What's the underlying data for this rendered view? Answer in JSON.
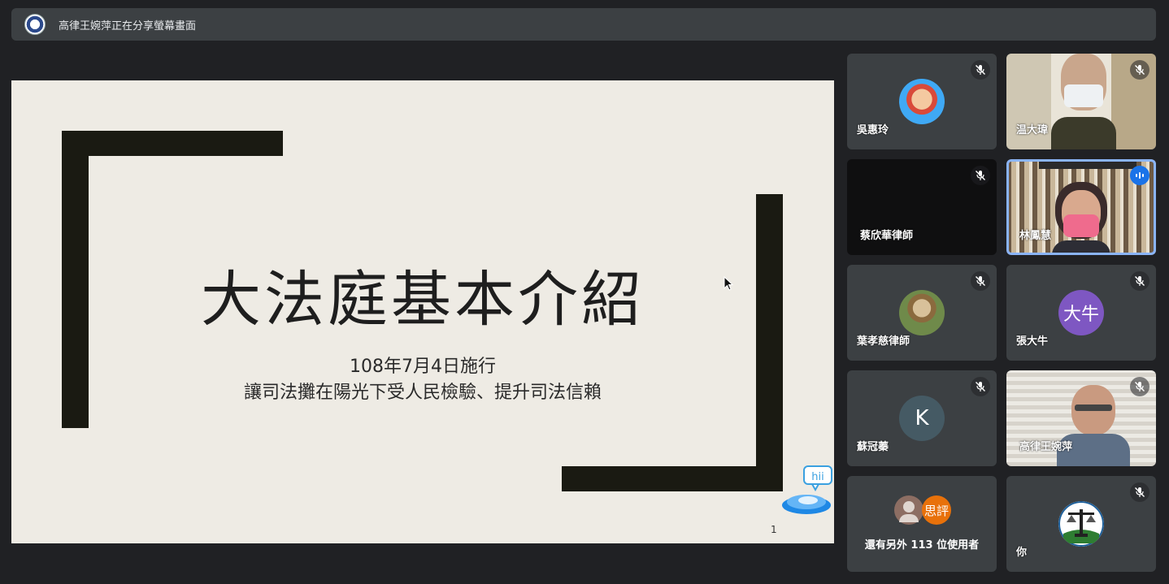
{
  "header": {
    "sharing_text": "高律王婉萍正在分享螢幕畫面"
  },
  "slide": {
    "title": "大法庭基本介紹",
    "subtitle_line1": "108年7月4日施行",
    "subtitle_line2": "讓司法攤在陽光下受人民檢驗、提升司法信賴",
    "page_number": "1",
    "mascot_text": "hii"
  },
  "participants": {
    "p1": {
      "name": "吳惠玲",
      "muted": true
    },
    "p2": {
      "name": "温大瑋",
      "muted": true
    },
    "p3": {
      "name": "蔡欣華律師",
      "muted": true
    },
    "p4": {
      "name": "林鳳慧",
      "speaking": true
    },
    "p5": {
      "name": "葉孝慈律師",
      "muted": true
    },
    "p6": {
      "name": "張大牛",
      "avatar_text": "大牛",
      "avatar_color": "#7e57c2",
      "muted": true
    },
    "p7": {
      "name": "蘇冠蓁",
      "avatar_text": "K",
      "avatar_color": "#455a64",
      "muted": true
    },
    "p8": {
      "name": "高律王婉萍",
      "muted": true
    },
    "more": {
      "label": "還有另外 113 位使用者",
      "avatar_text": "思評",
      "avatar_color": "#e8710a"
    },
    "self": {
      "name": "你",
      "muted": true
    }
  },
  "colors": {
    "speaking_ring": "#8ab4f8",
    "speaking_badge": "#1a73e8",
    "tile_bg": "#3c4043"
  }
}
